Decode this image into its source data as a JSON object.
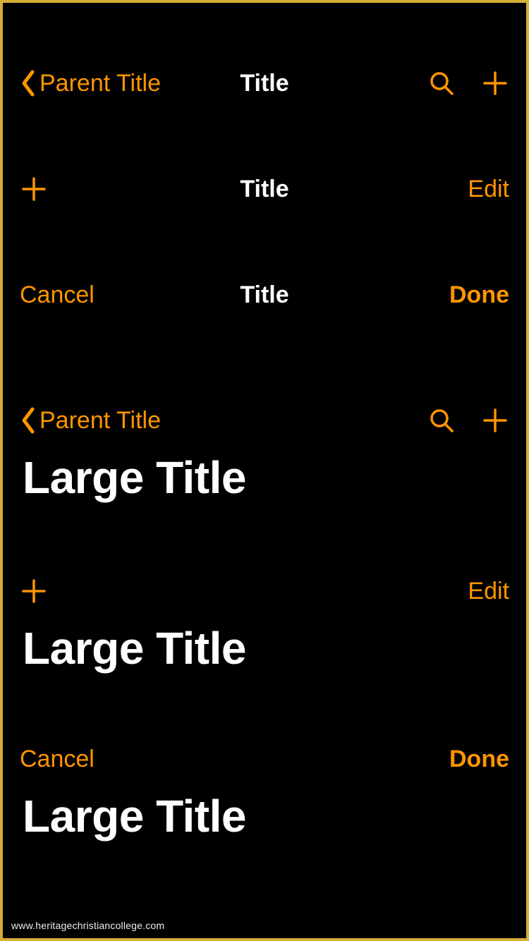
{
  "colors": {
    "accent": "#ff9500"
  },
  "buttons": {
    "parent": "Parent Title",
    "edit": "Edit",
    "cancel": "Cancel",
    "done": "Done"
  },
  "titles": {
    "small": "Title",
    "large": "Large Title"
  },
  "footer": "www.heritagechristiancollege.com"
}
